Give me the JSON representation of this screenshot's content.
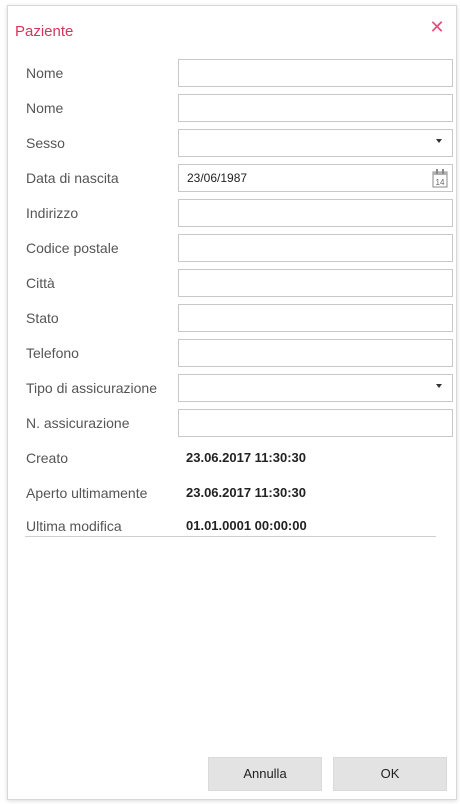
{
  "dialog": {
    "title": "Paziente"
  },
  "fields": [
    {
      "label": "Nome",
      "value": "",
      "type": "text"
    },
    {
      "label": "Nome",
      "value": "",
      "type": "text"
    },
    {
      "label": "Sesso",
      "value": "",
      "type": "select"
    },
    {
      "label": "Data di nascita",
      "value": "23/06/1987",
      "type": "date",
      "calendar_day": "14"
    },
    {
      "label": "Indirizzo",
      "value": "",
      "type": "text"
    },
    {
      "label": "Codice postale",
      "value": "",
      "type": "text"
    },
    {
      "label": "Città",
      "value": "",
      "type": "text"
    },
    {
      "label": "Stato",
      "value": "",
      "type": "text"
    },
    {
      "label": "Telefono",
      "value": "",
      "type": "text"
    },
    {
      "label": "Tipo di assicurazione",
      "value": "",
      "type": "select"
    },
    {
      "label": "N. assicurazione",
      "value": "",
      "type": "text"
    }
  ],
  "info": [
    {
      "label": "Creato",
      "value": "23.06.2017 11:30:30"
    },
    {
      "label": "Aperto ultimamente",
      "value": "23.06.2017 11:30:30"
    },
    {
      "label": "Ultima modifica",
      "value": "01.01.0001 00:00:00"
    }
  ],
  "buttons": {
    "cancel_label": "Annulla",
    "ok_label": "OK"
  },
  "colors": {
    "title": "#d9345a",
    "close": "#e0507a"
  },
  "icons": {
    "close": "close-icon",
    "calendar": "calendar-icon",
    "dropdown": "chevron-down-icon"
  }
}
